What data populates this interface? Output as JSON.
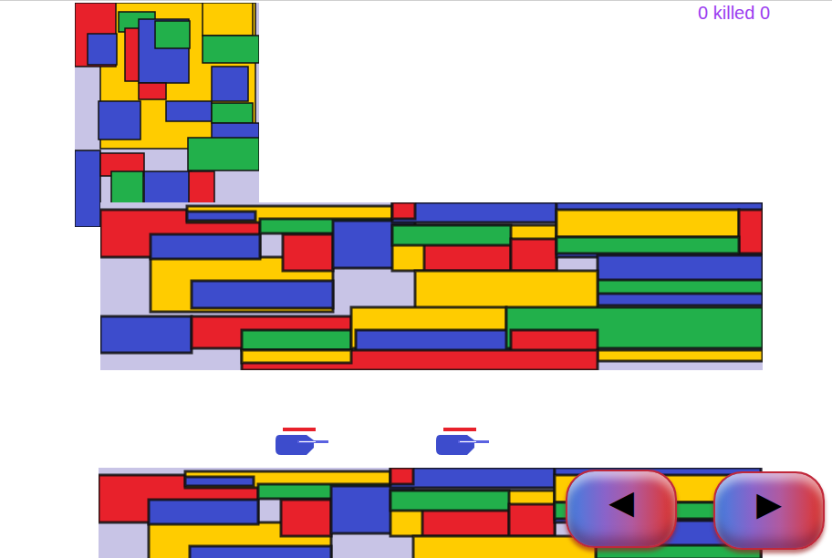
{
  "hud": {
    "score": "0 killed 0"
  },
  "tanks": [
    {
      "facing": "right"
    },
    {
      "facing": "right"
    }
  ],
  "controls": [
    {
      "label": "◀"
    },
    {
      "label": "▶"
    }
  ]
}
